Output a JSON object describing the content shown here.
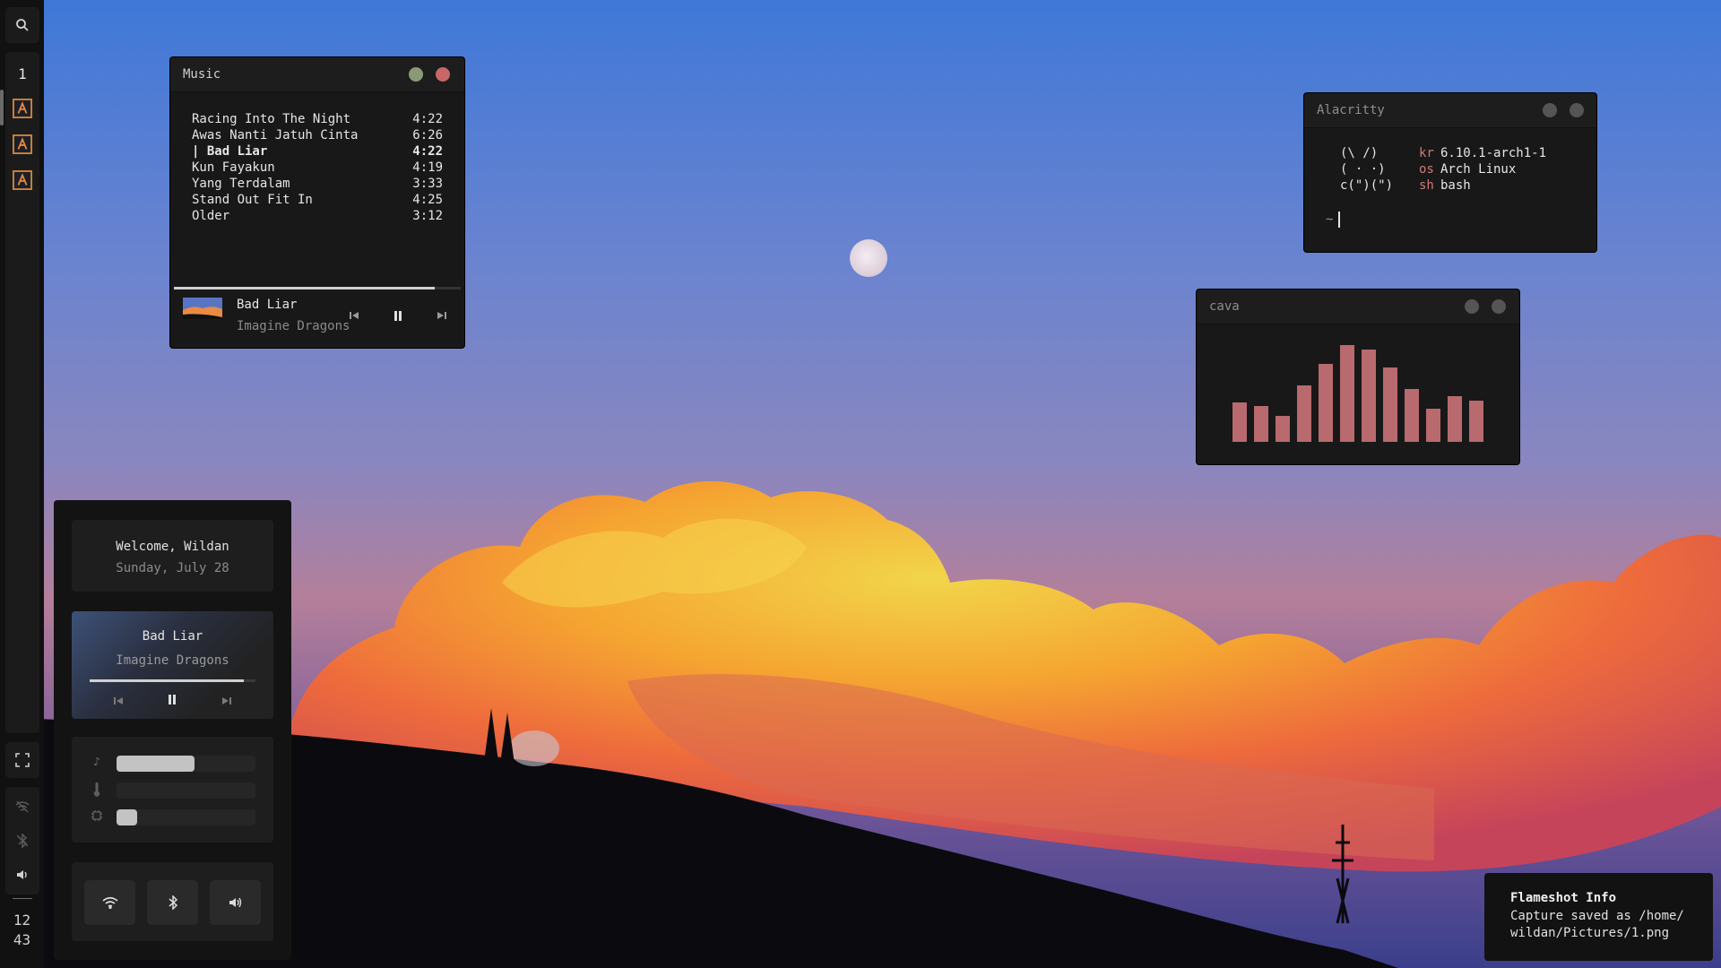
{
  "colors": {
    "accent": "#b86a6e",
    "dot_green": "#8a9a77",
    "dot_red": "#c76767",
    "dot_grey": "#555555",
    "app_icon_orange": "#c9843a"
  },
  "sidebar": {
    "search_icon": "search-icon",
    "workspace": "1",
    "app_icons": [
      "alacritty-icon",
      "alacritty-icon",
      "alacritty-icon"
    ],
    "fullscreen_icon": "fullscreen-icon",
    "status_icons": [
      "wifi-off-icon",
      "bluetooth-off-icon",
      "volume-icon"
    ],
    "clock": {
      "hour": "12",
      "minute": "43"
    }
  },
  "music": {
    "title": "Music",
    "tracks": [
      {
        "name": "Racing Into The Night",
        "duration": "4:22"
      },
      {
        "name": "Awas Nanti Jatuh Cinta",
        "duration": "6:26"
      },
      {
        "name": "| Bad Liar",
        "duration": "4:22"
      },
      {
        "name": "Kun Fayakun",
        "duration": "4:19"
      },
      {
        "name": "Yang Terdalam",
        "duration": "3:33"
      },
      {
        "name": "Stand Out Fit In",
        "duration": "4:25"
      },
      {
        "name": "Older",
        "duration": "3:12"
      }
    ],
    "current_index": 2,
    "progress": 0.91,
    "now_playing": {
      "title": "Bad Liar",
      "artist": "Imagine Dragons"
    }
  },
  "terminal": {
    "title": "Alacritty",
    "fetch": [
      {
        "art": "(\\ /)",
        "key": "kr",
        "value": "6.10.1-arch1-1"
      },
      {
        "art": "( · ·)",
        "key": "os",
        "value": "Arch Linux"
      },
      {
        "art": "c(\")(\")",
        "key": "sh",
        "value": "bash"
      }
    ],
    "prompt": "~"
  },
  "cava": {
    "title": "cava",
    "bars": [
      0.41,
      0.37,
      0.27,
      0.58,
      0.81,
      1.0,
      0.95,
      0.77,
      0.55,
      0.34,
      0.47,
      0.43
    ]
  },
  "dashboard": {
    "welcome": "Welcome, Wildan",
    "date": "Sunday, July 28",
    "player": {
      "title": "Bad Liar",
      "artist": "Imagine Dragons",
      "progress": 0.93
    },
    "sliders": [
      {
        "icon": "music-note-icon",
        "value": 0.56
      },
      {
        "icon": "thermometer-icon",
        "value": 0.0
      },
      {
        "icon": "cpu-icon",
        "value": 0.15
      }
    ],
    "quick_toggles": [
      "wifi-icon",
      "bluetooth-icon",
      "volume-icon"
    ]
  },
  "notification": {
    "title": "Flameshot Info",
    "body": "Capture saved as /home/ wildan/Pictures/1.png"
  }
}
